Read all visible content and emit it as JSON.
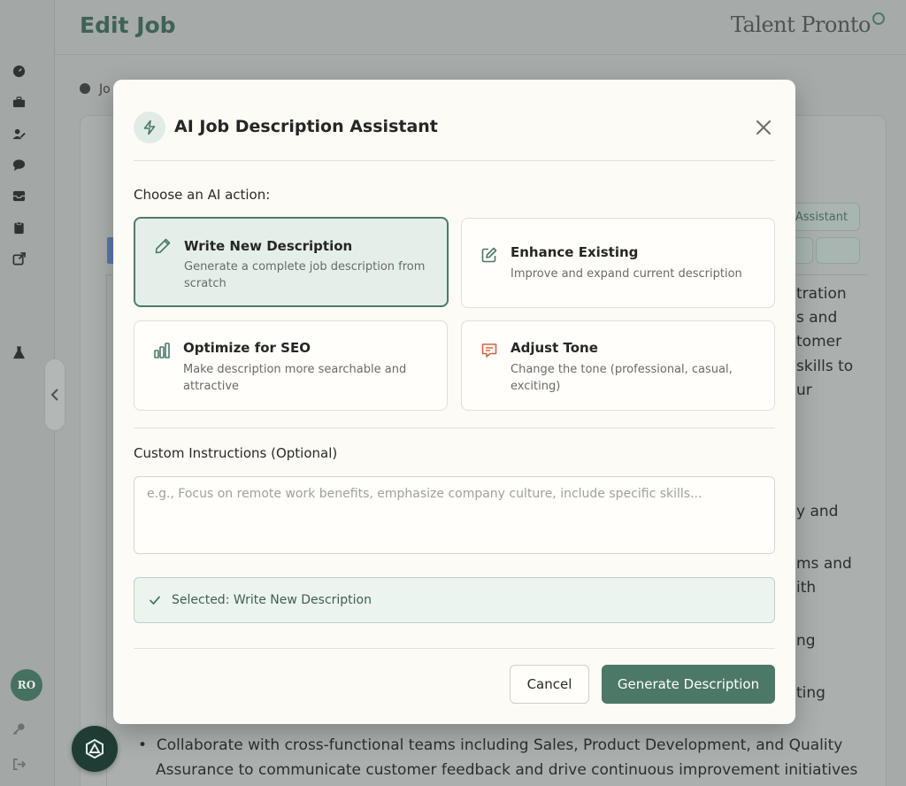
{
  "app": {
    "page_title": "Edit Job",
    "brand": "Talent Pronto",
    "breadcrumb": "Jo",
    "avatar_initials": "RO",
    "sidebar_icons": [
      "dashboard-icon",
      "briefcase-icon",
      "user-edit-icon",
      "chat-icon",
      "inbox-icon",
      "clipboard-icon",
      "external-link-icon",
      "flask-icon",
      "key-icon",
      "logout-icon"
    ]
  },
  "background": {
    "assistant_button": "Assistant",
    "visible_text": [
      "tration",
      "s and",
      "tomer",
      "skills to",
      "ur",
      "y and",
      "ms and",
      "ith",
      "ng",
      "ting"
    ],
    "bullet_line_1": "Collaborate with cross-functional teams including Sales, Product Development, and Quality",
    "bullet_line_2": "Assurance to communicate customer feedback and drive continuous improvement initiatives"
  },
  "modal": {
    "title": "AI Job Description Assistant",
    "choose_label": "Choose an AI action:",
    "options": [
      {
        "title": "Write New Description",
        "desc": "Generate a complete job description from scratch",
        "icon": "pencil-icon"
      },
      {
        "title": "Enhance Existing",
        "desc": "Improve and expand current description",
        "icon": "edit-square-icon"
      },
      {
        "title": "Optimize for SEO",
        "desc": "Make description more searchable and attractive",
        "icon": "bar-chart-icon"
      },
      {
        "title": "Adjust Tone",
        "desc": "Change the tone (professional, casual, exciting)",
        "icon": "message-icon"
      }
    ],
    "custom_label": "Custom Instructions (Optional)",
    "custom_placeholder": "e.g., Focus on remote work benefits, emphasize company culture, include specific skills...",
    "custom_value": "",
    "selected_text": "Selected: Write New Description",
    "cancel_label": "Cancel",
    "generate_label": "Generate Description"
  },
  "colors": {
    "accent": "#4c7867",
    "selected_bg": "#e5efe9",
    "warning_icon": "#d2663e"
  }
}
